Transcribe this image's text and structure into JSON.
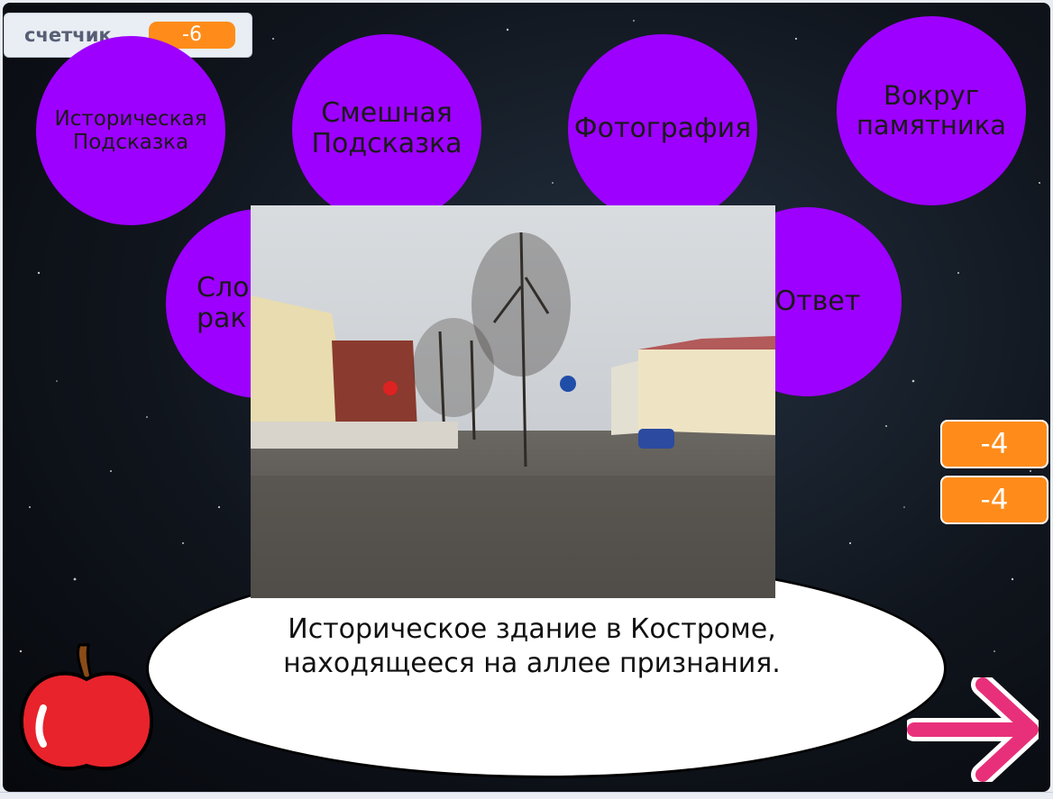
{
  "counter": {
    "label": "счетчик",
    "value": "-6"
  },
  "bubbles": [
    {
      "label": "Историческая\nПодсказка"
    },
    {
      "label": "Смешная\nПодсказка"
    },
    {
      "label": "Фотография"
    },
    {
      "label": "Вокруг\nпамятника"
    },
    {
      "label": "Сло\nрак"
    },
    {
      "label": "Ответ"
    }
  ],
  "caption": "Историческое здание в Костроме,\n находящееся на аллее признания.",
  "mini_counters": [
    "-4",
    "-4"
  ],
  "colors": {
    "bubble": "#9d00ff",
    "counter": "#ff8c1a",
    "arrow": "#e8307a",
    "apple": "#e8232b"
  },
  "icons": {
    "apple": "apple-sprite-icon",
    "arrow": "next-arrow-icon"
  }
}
